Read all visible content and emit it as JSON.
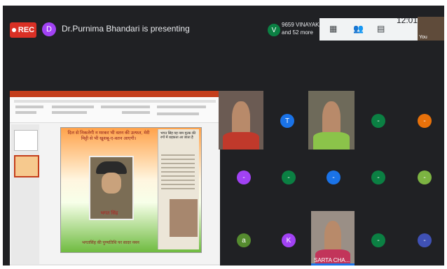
{
  "header": {
    "rec_label": "REC",
    "presenter_initial": "D",
    "presenting_text": "Dr.Purnima Bhandari is presenting",
    "participant_initial": "V",
    "participants_line1": "9659 VINAYAKA",
    "participants_line2": "and 52 more",
    "clock": "12:01",
    "you_label": "You"
  },
  "slide": {
    "top_text": "दिल से निकलेगी न मरकर भी वतन की उल्फत, मेरी मिट्टी से भी खुशबू-ए-वतन आएगी।",
    "portrait_name": "भगत सिंह",
    "caption": "भगतसिंह की पुण्यतिथि पर सादर नमन",
    "newspaper_text": "भगत सिंह वह नाम मुल्क की रगों में धड़कता आ जाता है"
  },
  "tiles": [
    {
      "initial": "T",
      "color": "#1a73e8"
    },
    {
      "initial": "-",
      "color": "#0b8043"
    },
    {
      "initial": "-",
      "color": "#e8710a"
    },
    {
      "initial": "-",
      "color": "#a142f4"
    },
    {
      "initial": "-",
      "color": "#0b8043"
    },
    {
      "initial": "-",
      "color": "#1a73e8"
    },
    {
      "initial": "-",
      "color": "#0b8043"
    },
    {
      "initial": "-",
      "color": "#7cb342"
    },
    {
      "initial": "a",
      "color": "#558b2f"
    },
    {
      "initial": "K",
      "color": "#a142f4"
    },
    {
      "initial": "-",
      "color": "#0b8043"
    },
    {
      "initial": "-",
      "color": "#3f51b5"
    }
  ],
  "active_speaker_name": "SARTA CHA..."
}
